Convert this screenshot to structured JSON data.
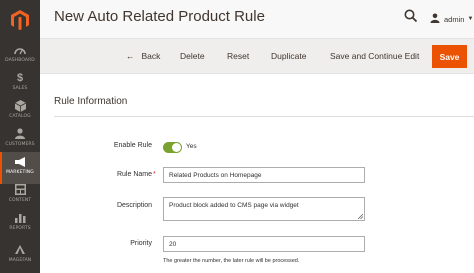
{
  "sidebar": {
    "items": [
      {
        "label": "DASHBOARD",
        "icon": "dashboard-icon"
      },
      {
        "label": "SALES",
        "icon": "dollar-icon"
      },
      {
        "label": "CATALOG",
        "icon": "cube-icon"
      },
      {
        "label": "CUSTOMERS",
        "icon": "customers-icon"
      },
      {
        "label": "MARKETING",
        "icon": "megaphone-icon"
      },
      {
        "label": "CONTENT",
        "icon": "content-icon"
      },
      {
        "label": "REPORTS",
        "icon": "reports-icon"
      },
      {
        "label": "MAGEFAN",
        "icon": "magefan-icon"
      }
    ]
  },
  "header": {
    "title": "New Auto Related Product Rule",
    "user": "admin"
  },
  "actions": {
    "back": "Back",
    "delete": "Delete",
    "reset": "Reset",
    "duplicate": "Duplicate",
    "save_continue": "Save and Continue Edit",
    "save": "Save"
  },
  "form": {
    "section_title": "Rule Information",
    "enable_label": "Enable Rule",
    "enable_value": "Yes",
    "name_label": "Rule Name",
    "name_value": "Related Products on Homepage",
    "description_label": "Description",
    "description_value": "Product block added to CMS page via widget",
    "priority_label": "Priority",
    "priority_value": "20",
    "priority_note": "The greater the number, the later rule will be processed."
  },
  "colors": {
    "sidebar_bg": "#373330",
    "accent": "#eb5202",
    "toggle_on": "#79a22e"
  }
}
